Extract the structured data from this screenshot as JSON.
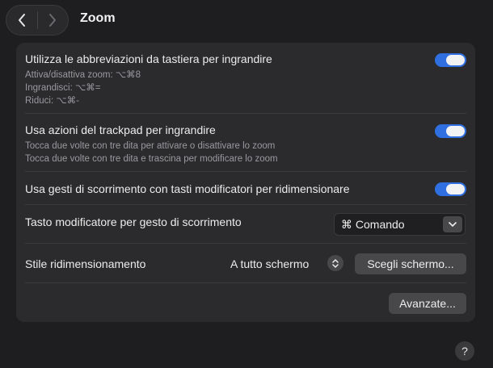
{
  "header": {
    "title": "Zoom"
  },
  "rows": {
    "keyboard": {
      "title": "Utilizza le abbreviazioni da tastiera per ingrandire",
      "lines": [
        "Attiva/disattiva zoom: ⌥⌘8",
        "Ingrandisci: ⌥⌘=",
        "Riduci: ⌥⌘-"
      ],
      "enabled": true
    },
    "trackpad": {
      "title": "Usa azioni del trackpad per ingrandire",
      "lines": [
        "Tocca due volte con tre dita per attivare o disattivare lo zoom",
        "Tocca due volte con tre dita e trascina per modificare lo zoom"
      ],
      "enabled": true
    },
    "scroll": {
      "title": "Usa gesti di scorrimento con tasti modificatori per ridimensionare",
      "enabled": true
    },
    "modifier": {
      "title": "Tasto modificatore per gesto di scorrimento",
      "value": "⌘ Comando"
    },
    "style": {
      "title": "Stile ridimensionamento",
      "value": "A tutto schermo",
      "button": "Scegli schermo..."
    }
  },
  "footer": {
    "advanced": "Avanzate...",
    "help": "?"
  },
  "colors": {
    "accent": "#2f6fe0",
    "panel": "#2b2b2d",
    "background": "#1e1e20"
  }
}
